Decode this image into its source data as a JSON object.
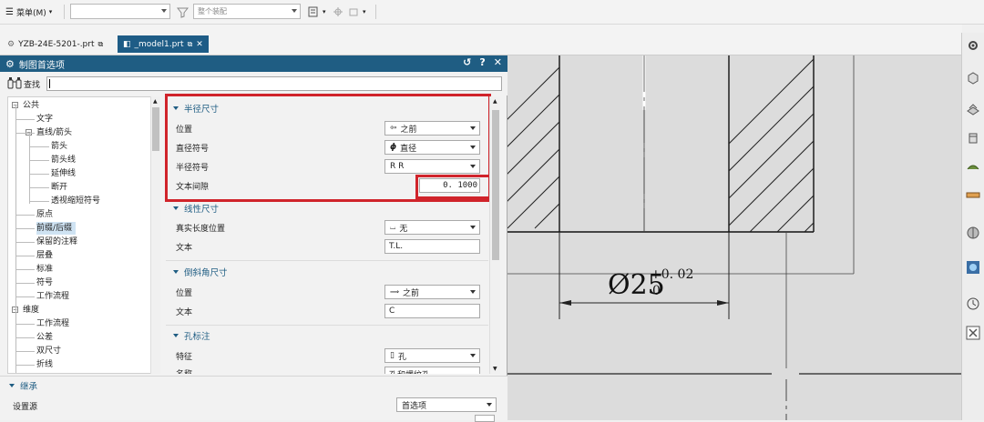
{
  "toolbar": {
    "menu_label": "菜单(M)",
    "filter_value": "",
    "assembly_combo": "整个装配"
  },
  "tabs": [
    {
      "label": "YZB-24E-5201-.prt",
      "active": false
    },
    {
      "label": "_model1.prt",
      "active": true
    }
  ],
  "dialog": {
    "title": "制图首选项",
    "title_buttons": [
      "↺",
      "?",
      "✕"
    ],
    "search_label": "查找",
    "search_value": ""
  },
  "tree": {
    "items": [
      {
        "label": "公共",
        "level": 0,
        "expander": "−"
      },
      {
        "label": "文字",
        "level": 1
      },
      {
        "label": "直线/箭头",
        "level": 1,
        "expander": "−"
      },
      {
        "label": "箭头",
        "level": 2
      },
      {
        "label": "箭头线",
        "level": 2
      },
      {
        "label": "延伸线",
        "level": 2
      },
      {
        "label": "断开",
        "level": 2
      },
      {
        "label": "透视缩短符号",
        "level": 2
      },
      {
        "label": "原点",
        "level": 1
      },
      {
        "label": "前缀/后缀",
        "level": 1,
        "selected": true
      },
      {
        "label": "保留的注释",
        "level": 1
      },
      {
        "label": "层叠",
        "level": 1
      },
      {
        "label": "标准",
        "level": 1
      },
      {
        "label": "符号",
        "level": 1
      },
      {
        "label": "工作流程",
        "level": 1
      },
      {
        "label": "维度",
        "level": 0,
        "expander": "−"
      },
      {
        "label": "工作流程",
        "level": 1
      },
      {
        "label": "公差",
        "level": 1
      },
      {
        "label": "双尺寸",
        "level": 1
      },
      {
        "label": "折线",
        "level": 1
      }
    ]
  },
  "sections": {
    "radius": {
      "title": "半径尺寸",
      "position_label": "位置",
      "position_value": "之前",
      "diameter_symbol_label": "直径符号",
      "diameter_symbol_glyph": "ϕ",
      "diameter_symbol_value": "直径",
      "radius_symbol_label": "半径符号",
      "radius_symbol_value": "R R",
      "text_gap_label": "文本间隙",
      "text_gap_value": "0. 1000"
    },
    "linear": {
      "title": "线性尺寸",
      "true_length_label": "真实长度位置",
      "true_length_value": "无",
      "text_label": "文本",
      "text_value": "T.L."
    },
    "chamfer": {
      "title": "倒斜角尺寸",
      "position_label": "位置",
      "position_value": "之前",
      "text_label": "文本",
      "text_value": "C"
    },
    "hole": {
      "title": "孔标注",
      "feature_label": "特征",
      "feature_value": "孔",
      "name_label": "名称",
      "name_value": "孔和螺纹孔"
    }
  },
  "inherit": {
    "title": "继承",
    "source_label": "设置源",
    "source_value": "首选项"
  },
  "drawing": {
    "dimension_symbol": "Ø25",
    "upper_tolerance": "+0. 02",
    "lower_tolerance": "0"
  },
  "colors": {
    "title_bar": "#1f5d83",
    "highlight": "#d0242b",
    "selection": "#cfe3f3"
  }
}
